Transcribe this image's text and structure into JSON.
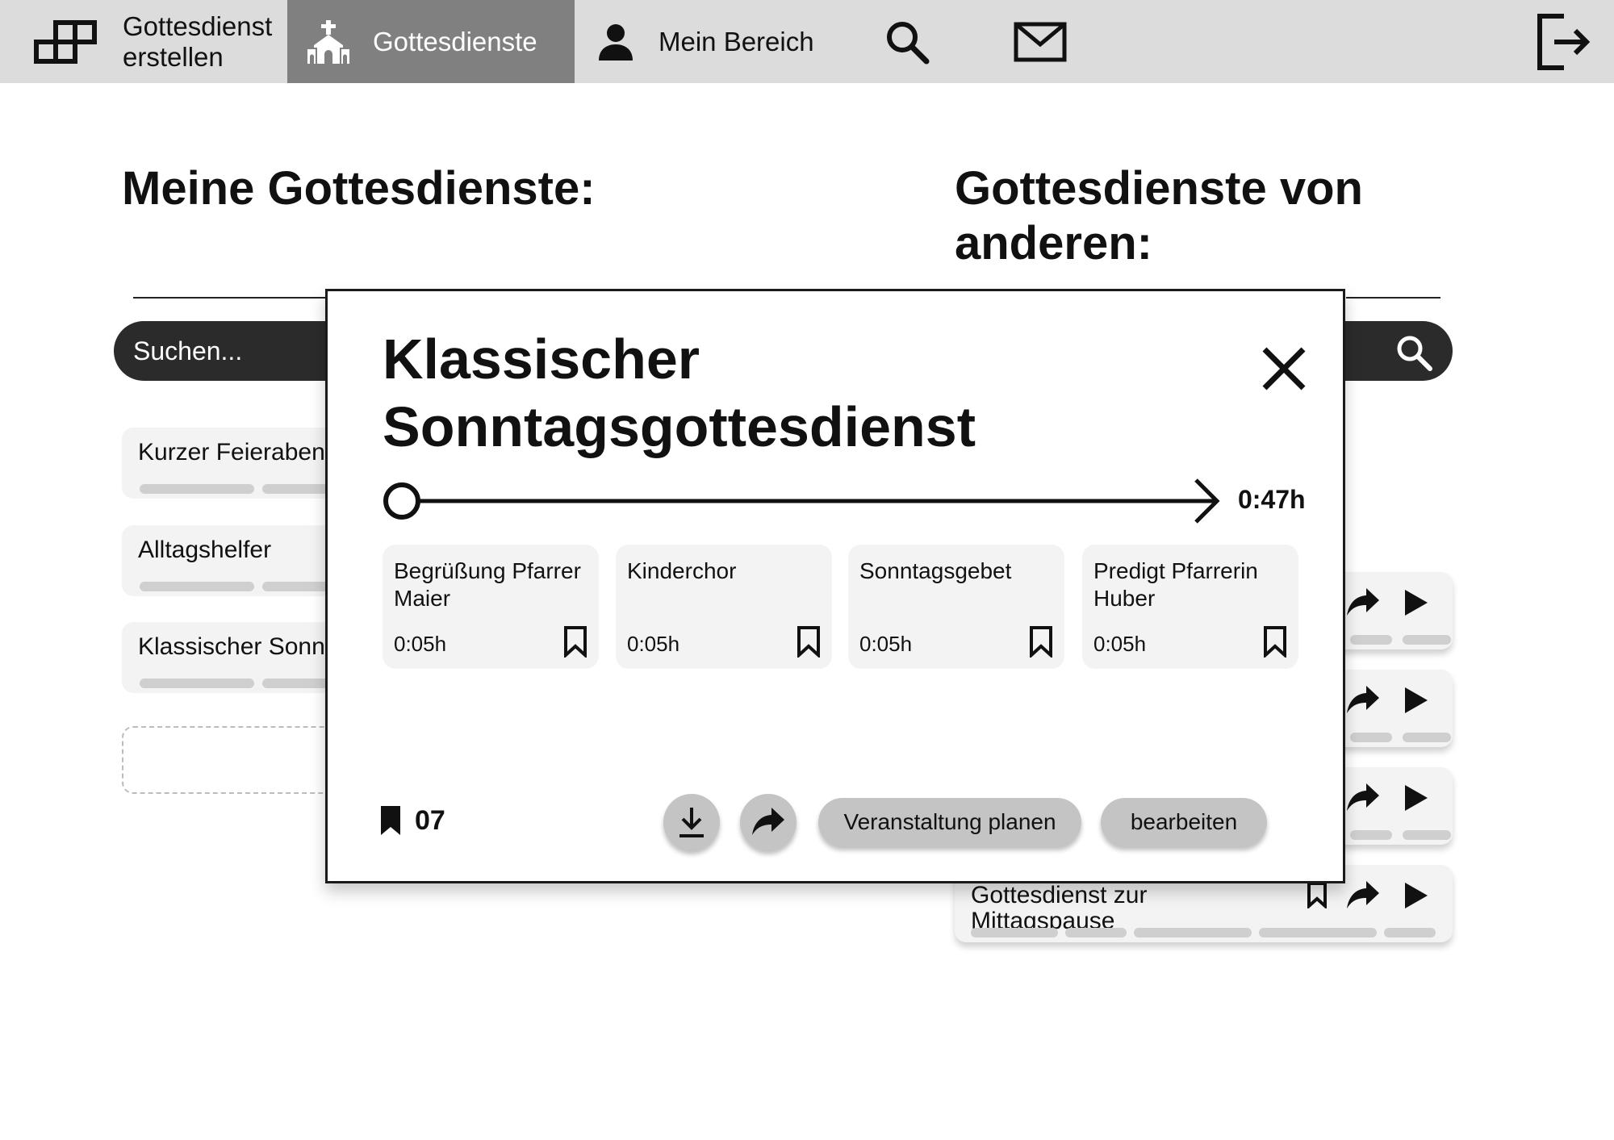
{
  "nav": {
    "create_label": "Gottesdienst\nerstellen",
    "create_line1": "Gottesdienst",
    "create_line2": "erstellen",
    "services_label": "Gottesdienste",
    "mine_label": "Mein Bereich",
    "icons": [
      "blocks-icon",
      "church-icon",
      "person-icon",
      "search-icon",
      "mail-icon",
      "logout-icon"
    ]
  },
  "sections": {
    "mine_title": "Meine Gottesdienste:",
    "others_title": "Gottesdienste von anderen:"
  },
  "search": {
    "placeholder": "Suchen..."
  },
  "my_services": [
    {
      "label": "Kurzer Feierabend"
    },
    {
      "label": "Alltagshelfer"
    },
    {
      "label": "Klassischer Sonntagsgottesdienst"
    }
  ],
  "other_services": {
    "last_label_line1": "Gottesdienst zur",
    "last_label_line2": "Mittagspause"
  },
  "modal": {
    "title": "Klassischer Sonntagsgottesdienst",
    "duration": "0:47h",
    "parts": [
      {
        "name": "Begrüßung Pfarrer Maier",
        "time": "0:05h"
      },
      {
        "name": "Kinderchor",
        "time": "0:05h"
      },
      {
        "name": "Sonntagsgebet",
        "time": "0:05h"
      },
      {
        "name": "Predigt Pfarrerin Huber",
        "time": "0:05h"
      }
    ],
    "saves_count": "07",
    "plan_label": "Veranstaltung planen",
    "edit_label": "bearbeiten"
  },
  "colors": {
    "nav_bg": "#dcdcdc",
    "nav_active_bg": "#808080",
    "search_bg": "#2b2b2b",
    "card_bg": "#f3f3f3",
    "button_bg": "#c4c4c4"
  }
}
